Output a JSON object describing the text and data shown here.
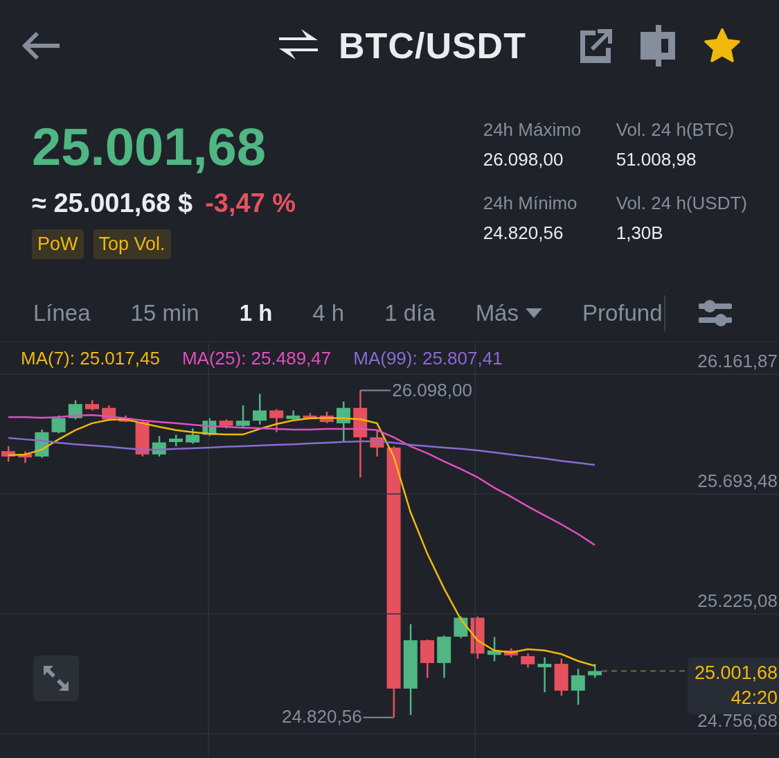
{
  "header": {
    "title": "BTC/USDT",
    "favorite": true
  },
  "price": {
    "last": "25.001,68",
    "fiat": "≈ 25.001,68 $",
    "change": "-3,47 %"
  },
  "tags": [
    "PoW",
    "Top Vol."
  ],
  "stats": [
    {
      "label": "24h Máximo",
      "value": "26.098,00"
    },
    {
      "label": "Vol. 24 h(BTC)",
      "value": "51.008,98"
    },
    {
      "label": "24h Mínimo",
      "value": "24.820,56"
    },
    {
      "label": "Vol. 24 h(USDT)",
      "value": "1,30B"
    }
  ],
  "intervals": [
    {
      "label": "Línea",
      "selected": false
    },
    {
      "label": "15 min",
      "selected": false
    },
    {
      "label": "1 h",
      "selected": true
    },
    {
      "label": "4 h",
      "selected": false
    },
    {
      "label": "1 día",
      "selected": false
    },
    {
      "label": "Más",
      "selected": false,
      "dropdown": true
    },
    {
      "label": "Profund",
      "selected": false
    }
  ],
  "chart": {
    "last_price_tag": {
      "price": "25.001,68",
      "countdown": "42:20"
    },
    "chart_data": {
      "type": "line",
      "grid": true,
      "ylim": [
        24664.6,
        26286.4
      ],
      "yticks": [
        {
          "value": 26161.87,
          "label": "26.161,87"
        },
        {
          "value": 25693.48,
          "label": "25.693,48"
        },
        {
          "value": 25225.08,
          "label": "25.225,08"
        },
        {
          "value": 24756.68,
          "label": "24.756,68"
        }
      ],
      "annotations": [
        {
          "text": "26.098,00"
        },
        {
          "text": "24.820,56"
        }
      ],
      "series": [
        {
          "name": "MA(7): 25.017,45",
          "color": "#f0b90b",
          "values": [
            25845,
            25848,
            25867,
            25907,
            25943,
            25970,
            25983,
            25986,
            25970,
            25956,
            25943,
            25935,
            25929,
            25926,
            25926,
            25948,
            25967,
            25981,
            25989,
            25991,
            25989,
            25986,
            25970,
            25840,
            25623,
            25461,
            25325,
            25204,
            25122,
            25082,
            25074,
            25087,
            25082,
            25068,
            25041,
            25022
          ]
        },
        {
          "name": "MA(25): 25.489,47",
          "color": "#e14fbd",
          "values": [
            25994,
            25994,
            25991,
            25994,
            26000,
            26002,
            25997,
            25989,
            25981,
            25975,
            25970,
            25964,
            25959,
            25956,
            25953,
            25951,
            25948,
            25945,
            25945,
            25948,
            25948,
            25948,
            25943,
            25915,
            25880,
            25853,
            25821,
            25791,
            25759,
            25718,
            25683,
            25645,
            25610,
            25575,
            25537,
            25494
          ]
        },
        {
          "name": "MA(99): 25.807,41",
          "color": "#8a6bd1",
          "values": [
            25913,
            25907,
            25902,
            25894,
            25888,
            25883,
            25878,
            25872,
            25867,
            25867,
            25870,
            25872,
            25875,
            25878,
            25880,
            25883,
            25886,
            25888,
            25891,
            25894,
            25897,
            25899,
            25899,
            25894,
            25886,
            25880,
            25875,
            25870,
            25864,
            25856,
            25848,
            25840,
            25832,
            25823,
            25815,
            25807
          ]
        }
      ]
    }
  }
}
